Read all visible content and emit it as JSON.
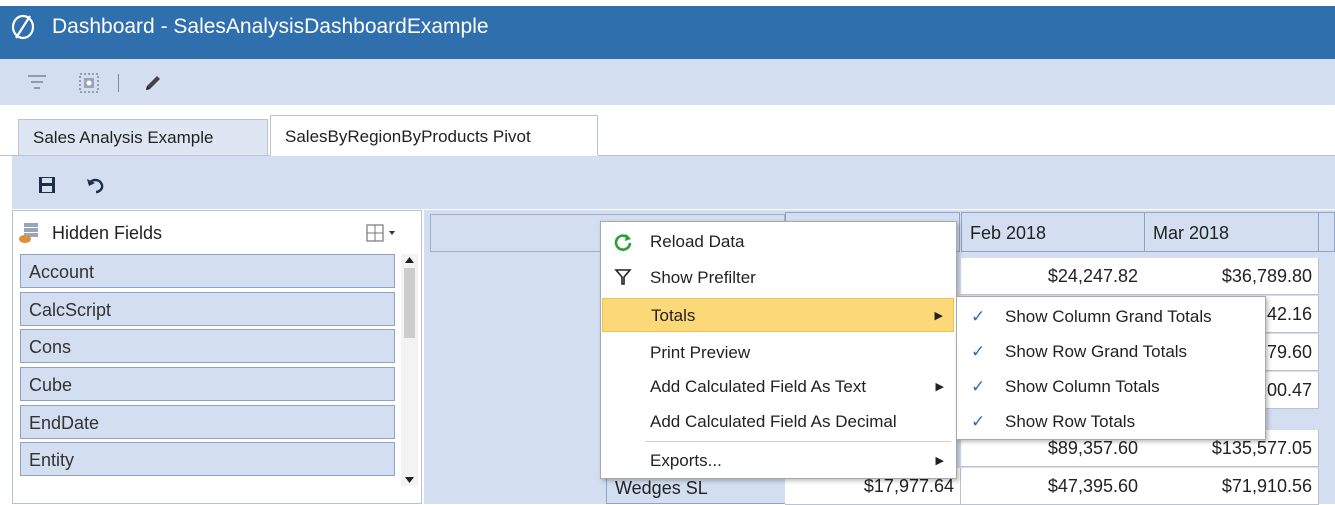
{
  "window": {
    "title": "Dashboard - SalesAnalysisDashboardExample"
  },
  "toolbar": {
    "icons": [
      "filter-icon",
      "select-icon",
      "pencil-icon"
    ]
  },
  "tabs": [
    {
      "label": "Sales Analysis Example",
      "active": false
    },
    {
      "label": "SalesByRegionByProducts Pivot",
      "active": true
    }
  ],
  "inner_toolbar": {
    "icons": [
      "save-icon",
      "undo-icon"
    ]
  },
  "hidden_fields": {
    "title": "Hidden Fields",
    "items": [
      "Account",
      "CalcScript",
      "Cons",
      "Cube",
      "EndDate",
      "Entity"
    ]
  },
  "pivot": {
    "columns": [
      "Feb 2018",
      "Mar 2018"
    ],
    "row_label": "Wedges SL",
    "cells": {
      "r1": [
        "$24,247.82",
        "$36,789.80"
      ],
      "r2": [
        "42.16"
      ],
      "r3": [
        "79.60"
      ],
      "r4": [
        "00.47"
      ],
      "r5": [
        "$89,357.60",
        "$135,577.05"
      ],
      "r6": [
        "$17,977.64",
        "$47,395.60",
        "$71,910.56"
      ]
    }
  },
  "context_menu": {
    "items": [
      {
        "label": "Reload Data",
        "icon": "refresh-icon"
      },
      {
        "label": "Show Prefilter",
        "icon": "filter-icon"
      },
      {
        "label": "Totals",
        "submenu": true,
        "highlighted": true
      },
      {
        "label": "Print Preview"
      },
      {
        "label": "Add Calculated Field As Text",
        "submenu": true
      },
      {
        "label": "Add Calculated Field As Decimal"
      },
      {
        "label": "Exports...",
        "submenu": true
      }
    ]
  },
  "totals_submenu": {
    "items": [
      {
        "label": "Show Column Grand Totals",
        "checked": true
      },
      {
        "label": "Show Row Grand Totals",
        "checked": true
      },
      {
        "label": "Show Column Totals",
        "checked": true
      },
      {
        "label": "Show Row Totals",
        "checked": true
      }
    ]
  },
  "colors": {
    "title_bar": "#2f6fae",
    "toolbar": "#d3def0",
    "menu_highlight": "#fbd878"
  }
}
